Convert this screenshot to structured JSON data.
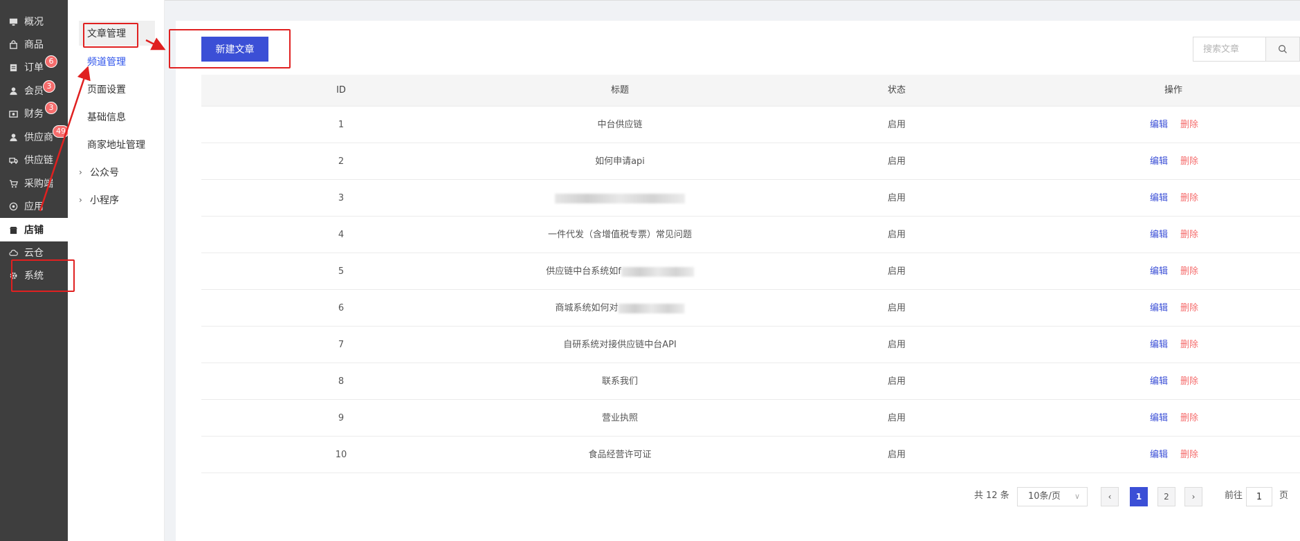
{
  "nav": {
    "items": [
      {
        "label": "概况",
        "icon": "monitor-icon"
      },
      {
        "label": "商品",
        "icon": "bag-icon"
      },
      {
        "label": "订单",
        "icon": "clipboard-icon",
        "badge": "6"
      },
      {
        "label": "会员",
        "icon": "user-icon",
        "badge": "3"
      },
      {
        "label": "财务",
        "icon": "wallet-icon",
        "badge": "3"
      },
      {
        "label": "供应商",
        "icon": "user-icon",
        "badge": "49"
      },
      {
        "label": "供应链",
        "icon": "truck-icon"
      },
      {
        "label": "采购端",
        "icon": "cart-icon"
      },
      {
        "label": "应用",
        "icon": "apps-icon"
      },
      {
        "label": "店铺",
        "icon": "store-icon",
        "active": true
      },
      {
        "label": "云仓",
        "icon": "cloud-icon"
      },
      {
        "label": "系统",
        "icon": "gear-icon"
      }
    ]
  },
  "submenu": {
    "items": [
      {
        "label": "文章管理"
      },
      {
        "label": "频道管理"
      },
      {
        "label": "页面设置"
      },
      {
        "label": "基础信息"
      },
      {
        "label": "商家地址管理"
      },
      {
        "label": "公众号"
      },
      {
        "label": "小程序"
      }
    ]
  },
  "toolbar": {
    "new_label": "新建文章",
    "search_placeholder": "搜索文章"
  },
  "table": {
    "headers": {
      "id": "ID",
      "title": "标题",
      "status": "状态",
      "action": "操作"
    },
    "rows": [
      {
        "id": "1",
        "title": "中台供应链",
        "status": "启用"
      },
      {
        "id": "2",
        "title": "如何申请api",
        "status": "启用"
      },
      {
        "id": "3",
        "title": "",
        "status": "启用"
      },
      {
        "id": "4",
        "title": "一件代发（含增值税专票）常见问题",
        "status": "启用"
      },
      {
        "id": "5",
        "title": "供应链中台系统如f",
        "status": "启用"
      },
      {
        "id": "6",
        "title": "商城系统如何对",
        "status": "启用"
      },
      {
        "id": "7",
        "title": "自研系统对接供应链中台API",
        "status": "启用"
      },
      {
        "id": "8",
        "title": "联系我们",
        "status": "启用"
      },
      {
        "id": "9",
        "title": "营业执照",
        "status": "启用"
      },
      {
        "id": "10",
        "title": "食品经营许可证",
        "status": "启用"
      }
    ],
    "edit_label": "编辑",
    "delete_label": "删除"
  },
  "pagination": {
    "total": "共 12 条",
    "page_size": "10条/页",
    "pages": [
      "1",
      "2"
    ],
    "current": "1",
    "goto_label": "前往",
    "goto_value": "1",
    "unit": "页"
  },
  "colors": {
    "accent": "#3b4fd6",
    "danger": "#f56c6c",
    "sidebar_bg": "#3e3e3e",
    "annotation": "#e02020"
  }
}
